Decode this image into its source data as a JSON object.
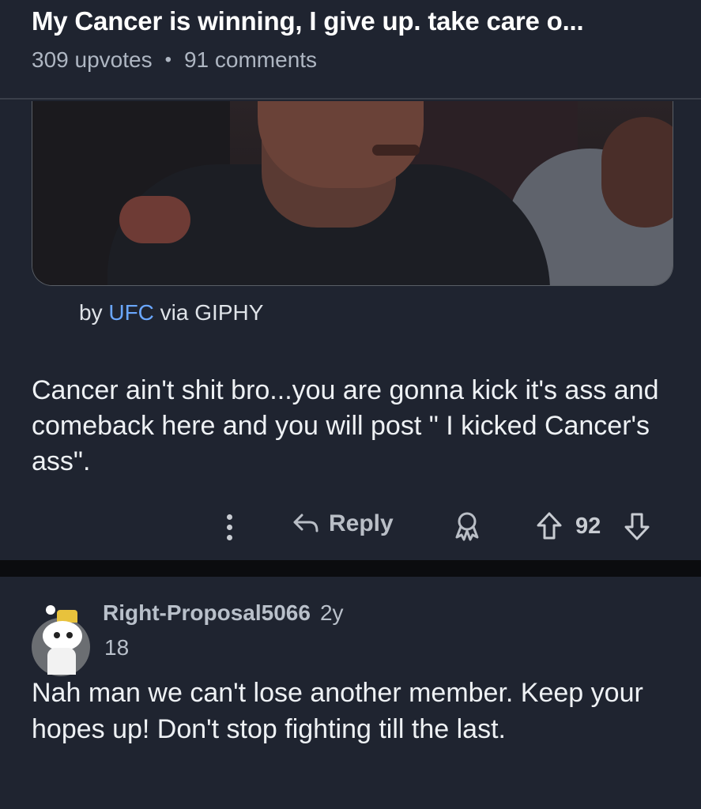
{
  "post": {
    "title": "My Cancer is winning, I give up. take care o...",
    "upvotes": "309 upvotes",
    "separator": "•",
    "comments": "91 comments"
  },
  "gif": {
    "credit_prefix": "by ",
    "credit_link": "UFC",
    "credit_suffix": " via GIPHY"
  },
  "comment": {
    "text": "Cancer ain't shit bro...you are gonna kick it's ass and comeback here and you will post \" I kicked Cancer's ass\".",
    "reply_label": "Reply",
    "score": "92"
  },
  "reply_comment": {
    "username": "Right-Proposal5066",
    "age": "2y",
    "score": "18",
    "text": "Nah man we can't lose another member. Keep your hopes up! Don't stop fighting till the last."
  },
  "colors": {
    "background": "#1f2430",
    "link": "#6aa7ff",
    "divider": "#0b0c0f"
  }
}
